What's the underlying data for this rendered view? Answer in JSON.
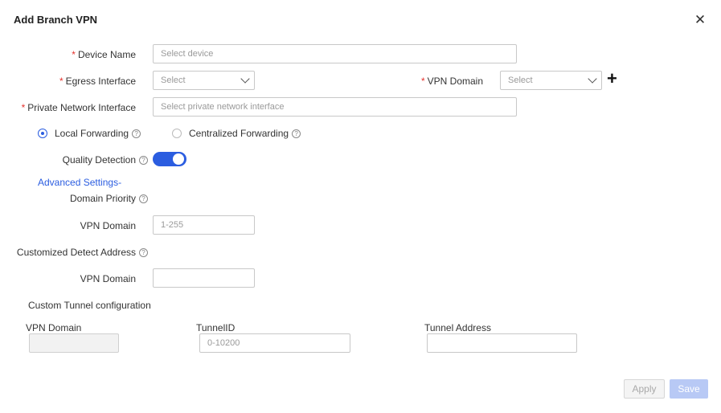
{
  "dialog": {
    "title": "Add Branch VPN",
    "close_icon": "close-icon"
  },
  "form": {
    "device_name": {
      "label": "Device Name",
      "required_mark": "*",
      "placeholder": "Select device"
    },
    "egress_interface": {
      "label": "Egress Interface",
      "required_mark": "*",
      "placeholder": "Select"
    },
    "vpn_domain": {
      "label": "VPN Domain",
      "required_mark": "*",
      "placeholder": "Select"
    },
    "private_network_interface": {
      "label": "Private Network Interface",
      "required_mark": "*",
      "placeholder": "Select private network interface"
    },
    "forwarding": {
      "local": {
        "label": "Local Forwarding",
        "selected": true
      },
      "centralized": {
        "label": "Centralized Forwarding",
        "selected": false
      }
    },
    "quality_detection": {
      "label": "Quality Detection",
      "enabled": true
    },
    "advanced_settings_link": "Advanced Settings-",
    "domain_priority": {
      "label": "Domain Priority"
    },
    "priority_vpn_domain": {
      "label": "VPN Domain",
      "placeholder": "1-255"
    },
    "customized_detect_address": {
      "label": "Customized Detect Address"
    },
    "detect_vpn_domain": {
      "label": "VPN Domain",
      "value": ""
    },
    "custom_tunnel": {
      "heading": "Custom Tunnel configuration",
      "columns": {
        "vpn_domain": "VPN Domain",
        "tunnel_id": "TunnelID",
        "tunnel_address": "Tunnel Address"
      },
      "tunnel_id_placeholder": "0-10200"
    }
  },
  "footer": {
    "apply": "Apply",
    "save": "Save"
  },
  "colors": {
    "accent": "#2b5de0",
    "required": "#e5322d",
    "save_disabled": "#b8c9f5"
  }
}
